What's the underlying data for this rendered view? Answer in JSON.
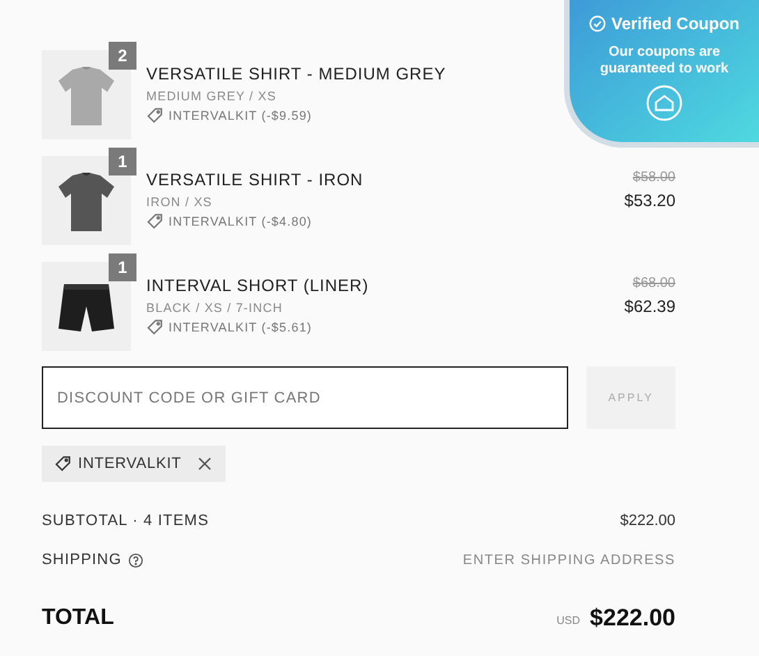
{
  "items": [
    {
      "quantity": "2",
      "title": "VERSATILE SHIRT - MEDIUM GREY",
      "variant": "MEDIUM GREY / XS",
      "discount": "INTERVALKIT (-$9.59)"
    },
    {
      "quantity": "1",
      "title": "VERSATILE SHIRT - IRON",
      "variant": "IRON / XS",
      "discount": "INTERVALKIT (-$4.80)",
      "original_price": "$58.00",
      "price": "$53.20"
    },
    {
      "quantity": "1",
      "title": "INTERVAL SHORT (LINER)",
      "variant": "BLACK / XS / 7-INCH",
      "discount": "INTERVALKIT (-$5.61)",
      "original_price": "$68.00",
      "price": "$62.39"
    }
  ],
  "discount_field": {
    "placeholder": "DISCOUNT CODE OR GIFT CARD"
  },
  "apply_button": {
    "label": "APPLY",
    "disabled": true
  },
  "applied_code": {
    "label": "INTERVALKIT"
  },
  "subtotal": {
    "label": "SUBTOTAL · 4 ITEMS",
    "value": "$222.00"
  },
  "shipping": {
    "label": "SHIPPING",
    "value": "ENTER SHIPPING ADDRESS"
  },
  "total": {
    "label": "TOTAL",
    "currency": "USD",
    "value": "$222.00"
  },
  "coupon_popup": {
    "title": "Verified Coupon",
    "message": "Our coupons are guaranteed to work"
  }
}
